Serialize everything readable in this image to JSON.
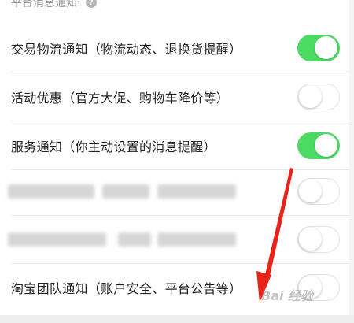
{
  "section": {
    "header": "平台消息通知:",
    "help_icon": "?"
  },
  "rows": [
    {
      "label": "交易物流通知（物流动态、退换货提醒）",
      "enabled": true
    },
    {
      "label": "活动优惠（官方大促、购物车降价等）",
      "enabled": false
    },
    {
      "label": "服务通知（你主动设置的消息提醒）",
      "enabled": true
    },
    {
      "label": "",
      "enabled": false
    },
    {
      "label": "",
      "enabled": false
    },
    {
      "label": "淘宝团队通知（账户安全、平台公告等）",
      "enabled": false
    }
  ],
  "watermark": "Bai 经验",
  "colors": {
    "toggle_on": "#4cd964",
    "toggle_off_border": "#e2e2e2",
    "arrow": "#e8231a"
  }
}
